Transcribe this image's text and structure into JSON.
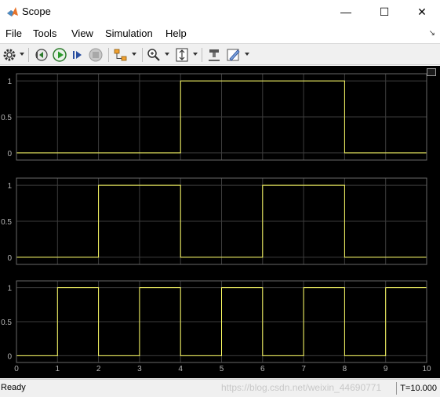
{
  "window": {
    "title": "Scope",
    "minimize_glyph": "—",
    "maximize_glyph": "☐",
    "close_glyph": "✕"
  },
  "menu": {
    "items": [
      "File",
      "Tools",
      "View",
      "Simulation",
      "Help"
    ]
  },
  "toolbar": {
    "icons": [
      "gear-icon",
      "step-back-icon",
      "run-icon",
      "step-forward-icon",
      "stop-icon",
      "signal-select-icon",
      "zoom-icon",
      "autoscale-icon",
      "highlight-icon",
      "edit-icon"
    ]
  },
  "colors": {
    "plot_background": "#000000",
    "axes_background": "#000000",
    "axes_border": "#686868",
    "grid": "#3c3c3c",
    "tick_label": "#b4b4b4",
    "signal": "#ffff64"
  },
  "chart_data": {
    "type": "line",
    "step": true,
    "grid": true,
    "xlim": [
      0,
      10
    ],
    "x_ticks": [
      "0",
      "1",
      "2",
      "3",
      "4",
      "5",
      "6",
      "7",
      "8",
      "9",
      "10"
    ],
    "plots": [
      {
        "ylim": [
          -0.1,
          1.1
        ],
        "y_ticks": [
          "1",
          "0.5",
          "0"
        ],
        "x": [
          0,
          4,
          4,
          8,
          8,
          10
        ],
        "y": [
          0,
          0,
          1,
          1,
          0,
          0
        ]
      },
      {
        "ylim": [
          -0.1,
          1.1
        ],
        "y_ticks": [
          "1",
          "0.5",
          "0"
        ],
        "x": [
          0,
          2,
          2,
          4,
          4,
          6,
          6,
          8,
          8,
          10
        ],
        "y": [
          0,
          0,
          1,
          1,
          0,
          0,
          1,
          1,
          0,
          0
        ]
      },
      {
        "ylim": [
          -0.1,
          1.1
        ],
        "y_ticks": [
          "1",
          "0.5",
          "0"
        ],
        "x": [
          0,
          1,
          1,
          2,
          2,
          3,
          3,
          4,
          4,
          5,
          5,
          6,
          6,
          7,
          7,
          8,
          8,
          9,
          9,
          10
        ],
        "y": [
          0,
          0,
          1,
          1,
          0,
          0,
          1,
          1,
          0,
          0,
          1,
          1,
          0,
          0,
          1,
          1,
          0,
          0,
          1,
          1
        ]
      }
    ]
  },
  "status": {
    "state": "Ready",
    "time": "T=10.000",
    "watermark": "https://blog.csdn.net/weixin_44690771"
  }
}
